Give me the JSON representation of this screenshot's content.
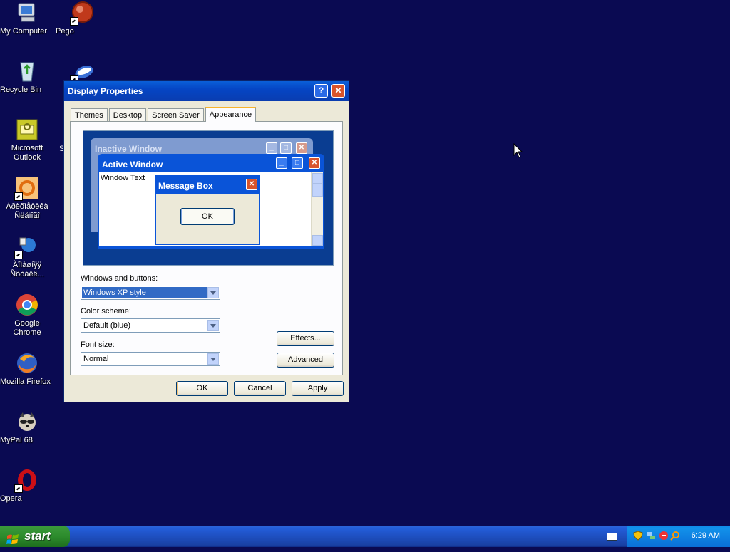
{
  "desktop": {
    "icons": [
      {
        "label": "My Computer",
        "name": "my-computer-icon"
      },
      {
        "label": "Pego",
        "name": "pego-icon"
      },
      {
        "label": "Recycle Bin",
        "name": "recycle-bin-icon"
      },
      {
        "label": "Microsoft Outlook",
        "name": "outlook-icon"
      },
      {
        "label": "Àðèõìåòèêà Ñëåïîãî",
        "name": "app-icon-1"
      },
      {
        "label": "Äîìàøíÿÿ Ñõòàëê...",
        "name": "app-icon-2"
      },
      {
        "label": "Google Chrome",
        "name": "chrome-icon"
      },
      {
        "label": "Mozilla Firefox",
        "name": "firefox-icon"
      },
      {
        "label": "MyPal 68",
        "name": "mypal-icon"
      },
      {
        "label": "Opera",
        "name": "opera-icon"
      }
    ],
    "partial_label": "S"
  },
  "dialog": {
    "title": "Display Properties",
    "help_glyph": "?",
    "close_glyph": "✕",
    "tabs": [
      "Themes",
      "Desktop",
      "Screen Saver",
      "Appearance"
    ],
    "active_tab": "Appearance",
    "preview": {
      "inactive_title": "Inactive Window",
      "active_title": "Active Window",
      "window_text": "Window Text",
      "message_box_title": "Message Box",
      "message_box_ok": "OK"
    },
    "windows_buttons_label": "Windows and buttons:",
    "windows_buttons_value": "Windows XP style",
    "color_scheme_label": "Color scheme:",
    "color_scheme_value": "Default (blue)",
    "font_size_label": "Font size:",
    "font_size_value": "Normal",
    "effects_button": "Effects...",
    "advanced_button": "Advanced",
    "ok_button": "OK",
    "cancel_button": "Cancel",
    "apply_button": "Apply"
  },
  "taskbar": {
    "start_label": "start",
    "clock": "6:29 AM"
  },
  "colors": {
    "desktop_bg": "#0a0a52",
    "dialog_bg": "#ece9d8",
    "title_blue": "#0545c4",
    "start_green": "#2d8c2d"
  }
}
